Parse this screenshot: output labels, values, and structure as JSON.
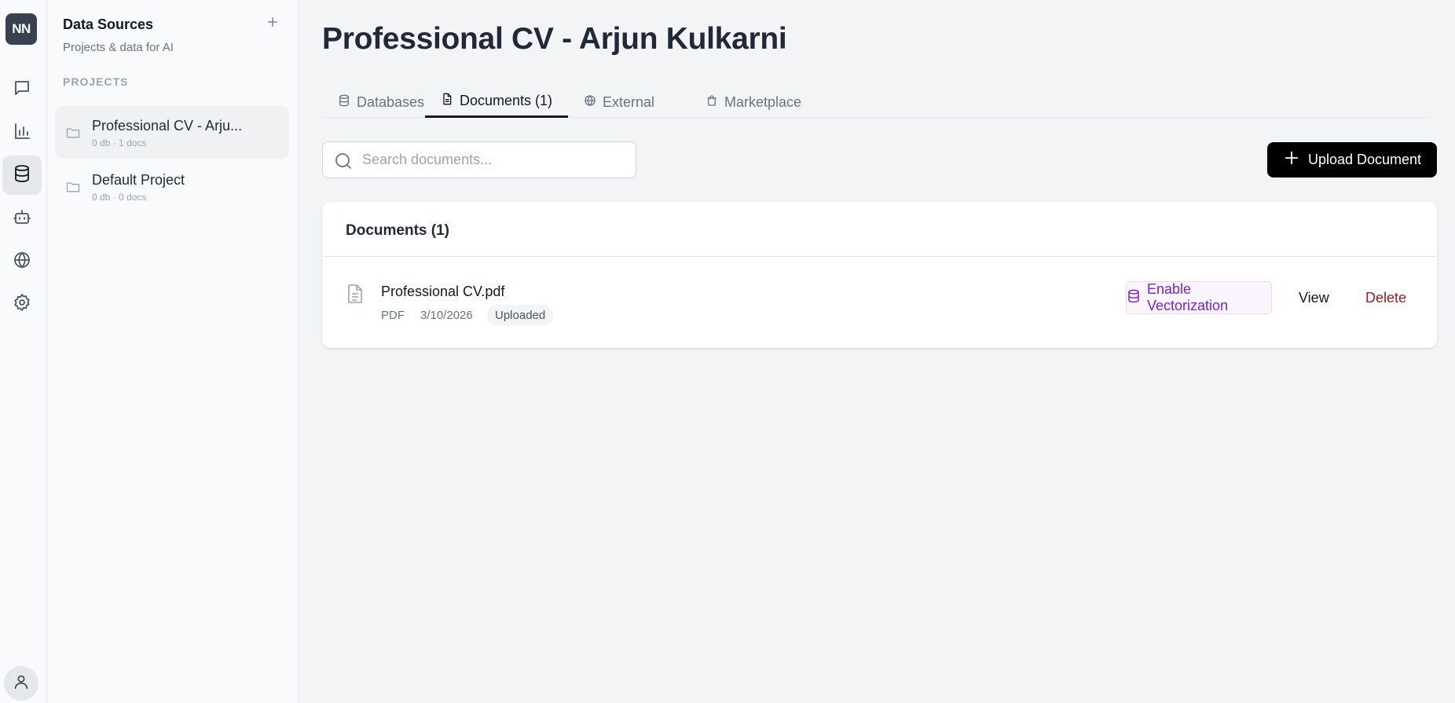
{
  "rail": {
    "logo": "NN",
    "items": [
      {
        "icon": "chat-icon"
      },
      {
        "icon": "bar-chart-icon"
      },
      {
        "icon": "database-icon",
        "active": true
      },
      {
        "icon": "bot-icon"
      },
      {
        "icon": "globe-icon"
      },
      {
        "icon": "gear-icon"
      }
    ],
    "profile_icon": "user-icon"
  },
  "sidebar": {
    "title": "Data Sources",
    "subtitle": "Projects & data for AI",
    "section_label": "PROJECTS",
    "projects": [
      {
        "name": "Professional CV - Arju...",
        "meta": "0 db · 1 docs",
        "active": true
      },
      {
        "name": "Default Project",
        "meta": "0 db · 0 docs",
        "active": false
      }
    ]
  },
  "main": {
    "title": "Professional CV - Arjun Kulkarni",
    "tabs": [
      {
        "label": "Databases",
        "icon": "database-icon"
      },
      {
        "label": "Documents (1)",
        "icon": "document-icon",
        "active": true
      },
      {
        "label": "External",
        "icon": "globe-icon"
      },
      {
        "label": "Marketplace",
        "icon": "shopping-bag-icon"
      }
    ],
    "search": {
      "placeholder": "Search documents...",
      "value": ""
    },
    "upload_label": "Upload Document",
    "documents_card": {
      "title": "Documents (1)",
      "rows": [
        {
          "name": "Professional CV.pdf",
          "type": "PDF",
          "date": "3/10/2026",
          "status": "Uploaded",
          "vectorize_label": "Enable Vectorization",
          "view_label": "View",
          "delete_label": "Delete"
        }
      ]
    }
  },
  "colors": {
    "accent_purple": "#7e22ce",
    "delete_red": "#991b1b",
    "primary_button": "#000000",
    "logo_bg": "#374151"
  }
}
